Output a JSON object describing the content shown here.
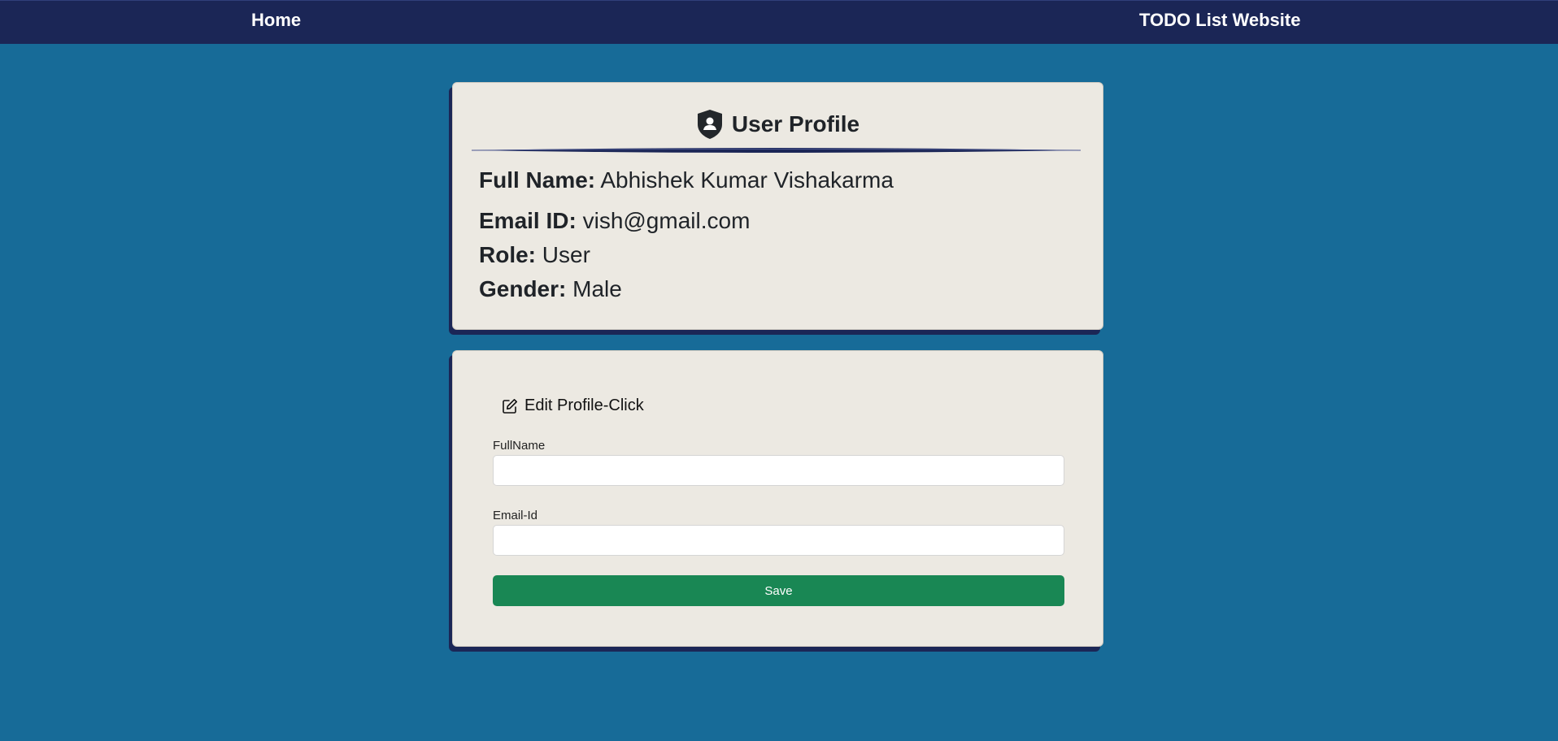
{
  "nav": {
    "home_label": "Home",
    "brand": "TODO List Website"
  },
  "profile": {
    "title": "User Profile",
    "title_icon": "shield-user-icon",
    "fields": {
      "full_name": {
        "label": "Full Name:",
        "value": "Abhishek Kumar Vishakarma"
      },
      "email": {
        "label": "Email ID:",
        "value": "vish@gmail.com"
      },
      "role": {
        "label": "Role:",
        "value": "User"
      },
      "gender": {
        "label": "Gender:",
        "value": "Male"
      }
    }
  },
  "edit": {
    "toggle_label": "Edit Profile-Click",
    "toggle_icon": "edit-icon",
    "fullname": {
      "label": "FullName",
      "value": "",
      "placeholder": ""
    },
    "email": {
      "label": "Email-Id",
      "value": "",
      "placeholder": ""
    },
    "save_label": "Save"
  },
  "colors": {
    "background": "#176b98",
    "navbar": "#1b2656",
    "card": "#ece9e2",
    "save_button": "#198754"
  }
}
